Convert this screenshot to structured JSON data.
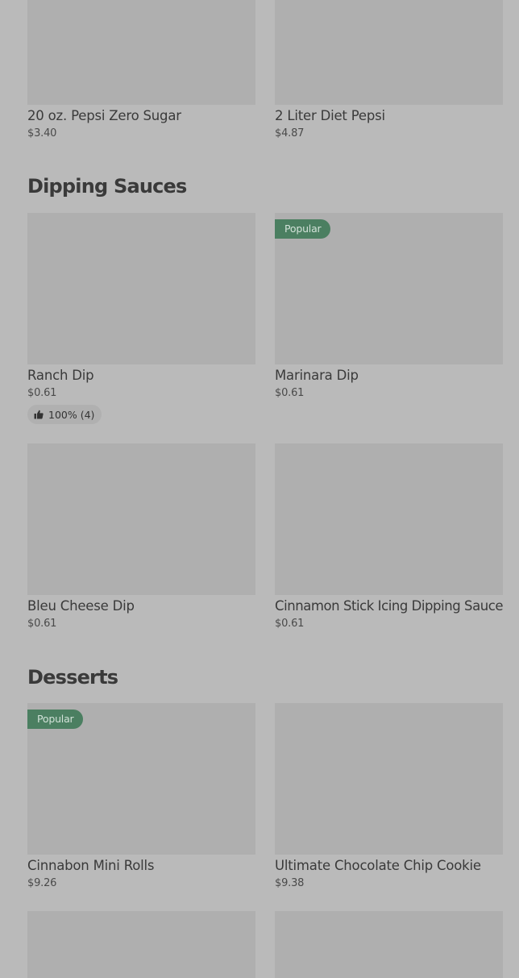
{
  "drinks": {
    "items": [
      {
        "name": "20 oz. Pepsi Zero Sugar",
        "price": "$3.40"
      },
      {
        "name": "2 Liter Diet Pepsi",
        "price": "$4.87"
      }
    ]
  },
  "dipping_sauces": {
    "title": "Dipping Sauces",
    "items": [
      {
        "name": "Ranch Dip",
        "price": "$0.61",
        "rating": "100% (4)"
      },
      {
        "name": "Marinara Dip",
        "price": "$0.61",
        "badge": "Popular"
      },
      {
        "name": "Bleu Cheese Dip",
        "price": "$0.61"
      },
      {
        "name": "Cinnamon Stick Icing Dipping Sauce",
        "price": "$0.61"
      }
    ]
  },
  "desserts": {
    "title": "Desserts",
    "items": [
      {
        "name": "Cinnabon Mini Rolls",
        "price": "$9.26",
        "badge": "Popular"
      },
      {
        "name": "Ultimate Chocolate Chip Cookie",
        "price": "$9.38"
      }
    ]
  },
  "colors": {
    "background": "#bababa",
    "image_placeholder": "#afafaf",
    "badge_bg": "#4b7f61",
    "badge_text": "#d3e2d9"
  }
}
